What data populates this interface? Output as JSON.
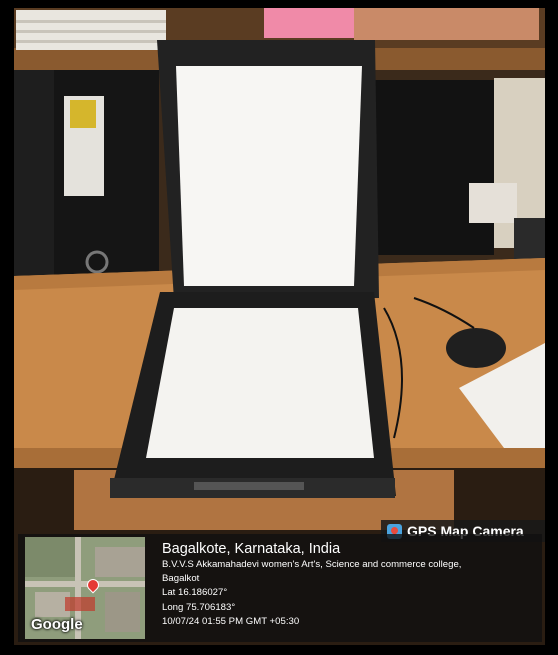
{
  "overlay": {
    "badge": {
      "icon": "map-pin-camera-icon",
      "label": "GPS Map Camera"
    },
    "map": {
      "brand": "Google",
      "pin_icon": "location-pin-icon"
    },
    "location": {
      "city": "Bagalkote, Karnataka, India",
      "address_line1": "B.V.V.S Akkamahadevi women's Art's, Science and commerce college,",
      "address_line2": "Bagalkot",
      "lat": "Lat 16.186027°",
      "long": "Long 75.706183°",
      "datetime": "10/07/24 01:55 PM GMT +05:30"
    }
  },
  "colors": {
    "badge_bg": "#191919",
    "panel_bg": "#0f0f0f",
    "pin": "#e53935",
    "badge_icon": "#4aa3df"
  }
}
